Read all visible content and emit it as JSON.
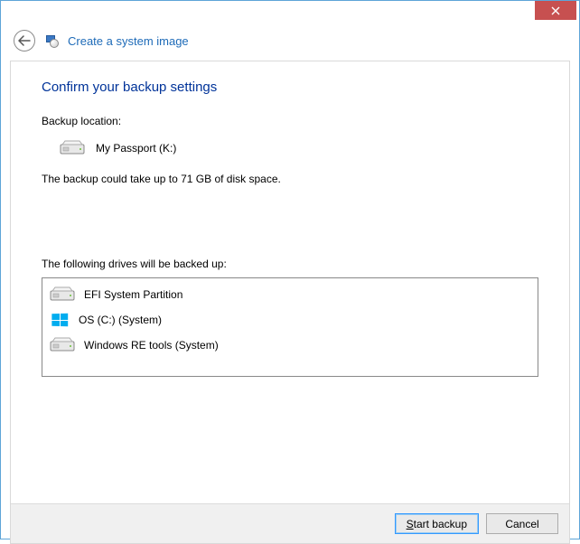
{
  "window": {
    "title": "Create a system image"
  },
  "page": {
    "heading": "Confirm your backup settings",
    "location_label": "Backup location:",
    "location_value": "My Passport (K:)",
    "size_note": "The backup could take up to 71 GB of disk space.",
    "drives_label": "The following drives will be backed up:",
    "drives": [
      {
        "icon": "drive",
        "label": "EFI System Partition"
      },
      {
        "icon": "windows",
        "label": "OS (C:) (System)"
      },
      {
        "icon": "drive",
        "label": "Windows RE tools (System)"
      }
    ]
  },
  "footer": {
    "start_mn": "S",
    "start_rest": "tart backup",
    "cancel": "Cancel"
  }
}
